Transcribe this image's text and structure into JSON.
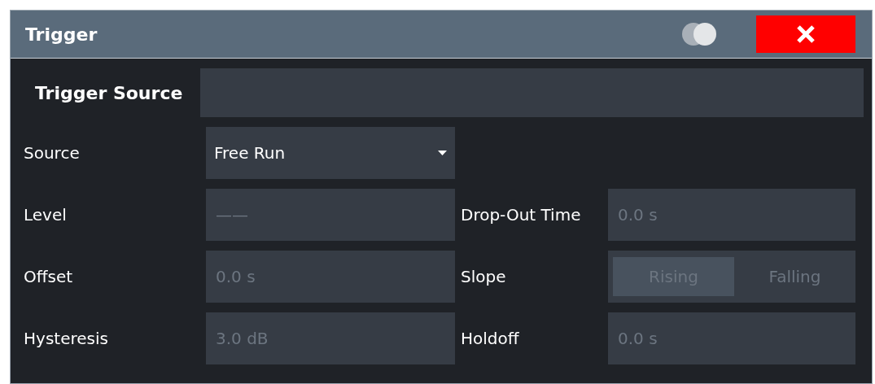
{
  "window": {
    "title": "Trigger"
  },
  "tabs": [
    {
      "label": "Trigger Source",
      "selected": true
    }
  ],
  "rows": [
    {
      "fields": [
        {
          "kind": "dropdown",
          "label": "Source",
          "value": "Free Run",
          "disabled": false
        }
      ]
    },
    {
      "fields": [
        {
          "kind": "input",
          "label": "Level",
          "value": "——",
          "disabled": true
        },
        {
          "kind": "input",
          "label": "Drop-Out Time",
          "value": "0.0 s",
          "disabled": true
        }
      ]
    },
    {
      "fields": [
        {
          "kind": "input",
          "label": "Offset",
          "value": "0.0 s",
          "disabled": true
        },
        {
          "kind": "segmented",
          "label": "Slope",
          "disabled": true,
          "options": [
            {
              "label": "Rising",
              "selected": true
            },
            {
              "label": "Falling",
              "selected": false
            }
          ]
        }
      ]
    },
    {
      "fields": [
        {
          "kind": "input",
          "label": "Hysteresis",
          "value": "3.0 dB",
          "disabled": true
        },
        {
          "kind": "input",
          "label": "Holdoff",
          "value": "0.0 s",
          "disabled": true
        }
      ]
    }
  ]
}
